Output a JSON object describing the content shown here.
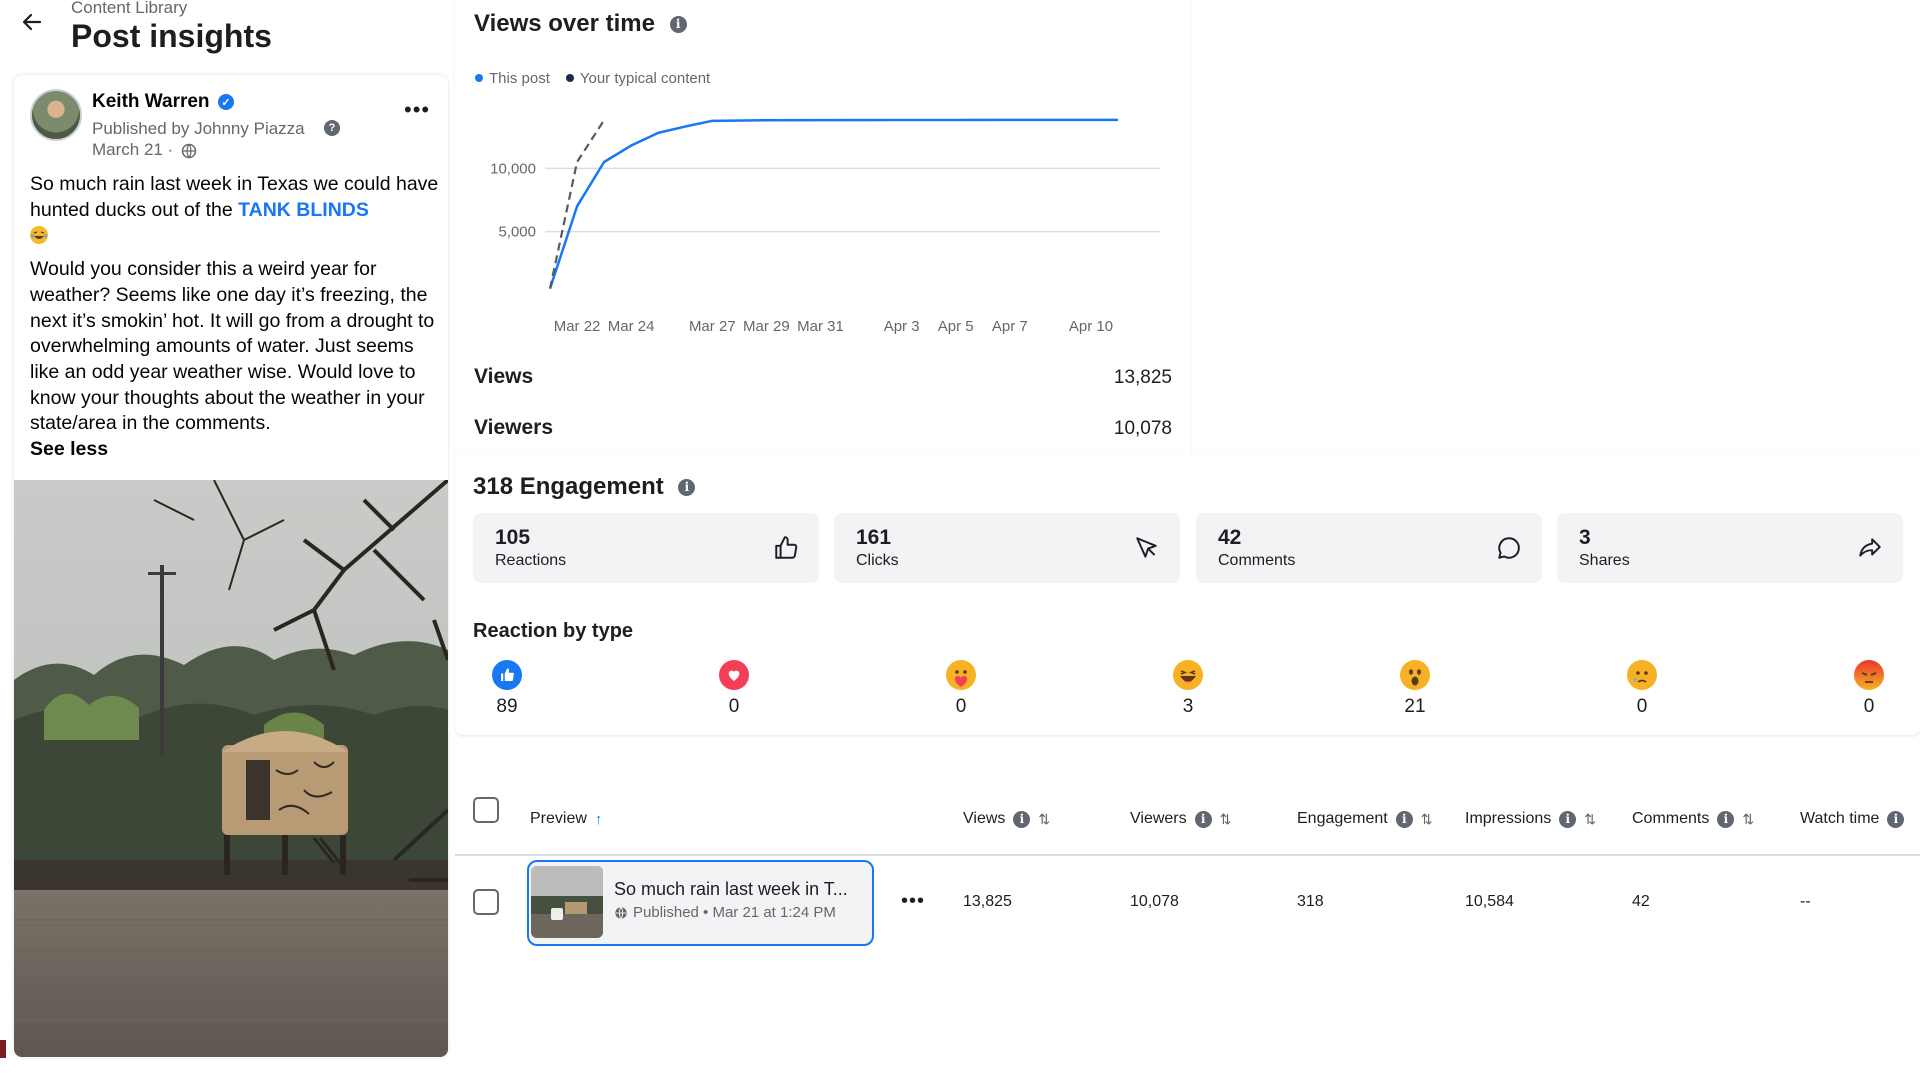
{
  "header": {
    "breadcrumb": "Content Library",
    "title": "Post insights"
  },
  "post": {
    "author": "Keith Warren",
    "published_by": "Published by Johnny Piazza",
    "published_sep": "·",
    "date": "March 21 ·",
    "text_p1_before_link": "So much rain last week in Texas we could have hunted ducks out of the ",
    "text_p1_link": "TANK BLINDS",
    "text_p2": "Would you consider this a weird year for weather? Seems like one day it’s freezing, the next it’s smokin’ hot. It will go from a drought to overwhelming amounts of water. Just seems like an odd year weather wise. Would love to know your thoughts about the weather in your state/area in the comments.",
    "see_less": "See less"
  },
  "views_over_time": {
    "title": "Views over time",
    "legend": [
      "This post",
      "Your typical content"
    ],
    "colors": {
      "this_post": "#1877f2",
      "typical": "#1c2b4a"
    },
    "views_label": "Views",
    "views_value": "13,825",
    "viewers_label": "Viewers",
    "viewers_value": "10,078"
  },
  "chart_data": {
    "type": "line",
    "x_ticks": [
      "Mar 22",
      "Mar 24",
      "Mar 27",
      "Mar 29",
      "Mar 31",
      "Apr 3",
      "Apr 5",
      "Apr 7",
      "Apr 10"
    ],
    "y_ticks": [
      "5,000",
      "10,000"
    ],
    "ylim": [
      0,
      15000
    ],
    "grid": true,
    "series": [
      {
        "name": "This post",
        "style": "solid",
        "x": [
          "Mar 21",
          "Mar 22",
          "Mar 23",
          "Mar 24",
          "Mar 25",
          "Mar 26",
          "Mar 27",
          "Mar 29",
          "Mar 31",
          "Apr 3",
          "Apr 5",
          "Apr 7",
          "Apr 10",
          "Apr 11"
        ],
        "values": [
          500,
          7000,
          10500,
          11800,
          12800,
          13300,
          13750,
          13800,
          13810,
          13815,
          13820,
          13822,
          13825,
          13825
        ]
      },
      {
        "name": "Your typical content",
        "style": "dashed",
        "x": [
          "Mar 21",
          "Mar 22",
          "Mar 23"
        ],
        "values": [
          500,
          10500,
          13800
        ]
      }
    ]
  },
  "engagement": {
    "title": "318 Engagement",
    "metrics": [
      {
        "value": "105",
        "label": "Reactions",
        "icon": "thumbs-up-icon"
      },
      {
        "value": "161",
        "label": "Clicks",
        "icon": "cursor-icon"
      },
      {
        "value": "42",
        "label": "Comments",
        "icon": "comment-icon"
      },
      {
        "value": "3",
        "label": "Shares",
        "icon": "share-icon"
      }
    ],
    "reaction_title": "Reaction by type",
    "reactions": [
      {
        "type": "like",
        "count": "89",
        "color": "#1877f2"
      },
      {
        "type": "love",
        "count": "0",
        "color": "#f33e58"
      },
      {
        "type": "care",
        "count": "0",
        "color": "#f7b125"
      },
      {
        "type": "haha",
        "count": "3",
        "color": "#f7b125"
      },
      {
        "type": "wow",
        "count": "21",
        "color": "#f7b125"
      },
      {
        "type": "sad",
        "count": "0",
        "color": "#f7b125"
      },
      {
        "type": "angry",
        "count": "0",
        "color": "#e9710f"
      }
    ]
  },
  "table": {
    "columns": [
      "Preview",
      "Views",
      "Viewers",
      "Engagement",
      "Impressions",
      "Comments",
      "Watch time"
    ],
    "row": {
      "title": "So much rain last week in T...",
      "meta": "Published • Mar 21 at 1:24 PM",
      "views": "13,825",
      "viewers": "10,078",
      "engagement": "318",
      "impressions": "10,584",
      "comments": "42",
      "watch_time": "--"
    }
  }
}
